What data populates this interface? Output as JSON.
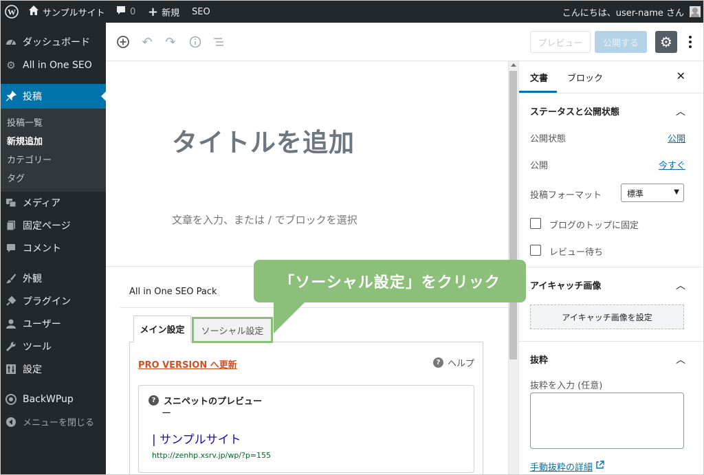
{
  "adminbar": {
    "site_name": "サンプルサイト",
    "comments_count": "0",
    "new_label": "新規",
    "seo_label": "SEO",
    "greeting": "こんにちは、user-name さん"
  },
  "sidebar": {
    "items": [
      {
        "label": "ダッシュボード",
        "icon": "dashboard-icon"
      },
      {
        "label": "All in One SEO",
        "icon": "gear-icon"
      },
      {
        "label": "投稿",
        "icon": "pin-icon"
      },
      {
        "label": "メディア",
        "icon": "media-icon"
      },
      {
        "label": "固定ページ",
        "icon": "page-icon"
      },
      {
        "label": "コメント",
        "icon": "comment-icon"
      },
      {
        "label": "外観",
        "icon": "brush-icon"
      },
      {
        "label": "プラグイン",
        "icon": "plugin-icon"
      },
      {
        "label": "ユーザー",
        "icon": "user-icon"
      },
      {
        "label": "ツール",
        "icon": "wrench-icon"
      },
      {
        "label": "設定",
        "icon": "settings-icon"
      },
      {
        "label": "BackWPup",
        "icon": "backwpup-icon"
      },
      {
        "label": "メニューを閉じる",
        "icon": "collapse-icon"
      }
    ],
    "submenu": [
      "投稿一覧",
      "新規追加",
      "カテゴリー",
      "タグ"
    ]
  },
  "toolbar": {
    "preview_label": "プレビュー",
    "publish_label": "公開する"
  },
  "editor": {
    "title_placeholder": "タイトルを追加",
    "body_placeholder": "文章を入力、または / でブロックを選択"
  },
  "seo_box": {
    "title": "All in One SEO Pack",
    "tabs": [
      "メイン設定",
      "ソーシャル設定"
    ],
    "pro_link": "PRO VERSION へ更新",
    "help_label": "ヘルプ",
    "snippet_title": "スニペットのプレビュー",
    "snippet_dash": "ー",
    "snippet_site": "| サンプルサイト",
    "snippet_url": "http://zenhp.xsrv.jp/wp/?p=155"
  },
  "callout": {
    "text": "「ソーシャル設定」をクリック",
    "color": "#8cc07a"
  },
  "panel": {
    "tabs": [
      "文書",
      "ブロック"
    ],
    "status_section": "ステータスと公開状態",
    "visibility_label": "公開状態",
    "visibility_value": "公開",
    "publish_label": "公開",
    "publish_value": "今すぐ",
    "format_label": "投稿フォーマット",
    "format_value": "標準",
    "sticky_label": "ブログのトップに固定",
    "pending_label": "レビュー待ち",
    "featured_section": "アイキャッチ画像",
    "featured_button": "アイキャッチ画像を設定",
    "excerpt_section": "抜粋",
    "excerpt_label": "抜粋を入力 (任意)",
    "excerpt_link": "手動抜粋の詳細"
  },
  "colors": {
    "admin_bg": "#23282d",
    "accent": "#0073aa",
    "pro_link": "#d54e21",
    "snippet_title": "#1a0dab",
    "snippet_url": "#006621"
  }
}
